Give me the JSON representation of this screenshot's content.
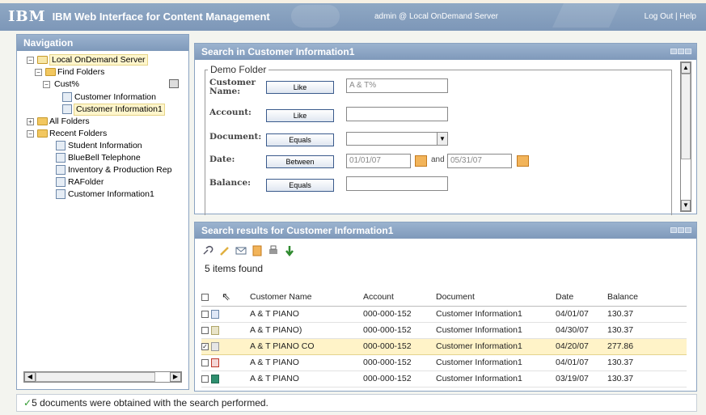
{
  "header": {
    "logo": "IBM",
    "title": "IBM Web Interface for Content Management",
    "user": "admin @ Local OnDemand Server",
    "logout": "Log Out",
    "separator": "|",
    "help": "Help"
  },
  "navigation": {
    "title": "Navigation",
    "tree": {
      "server": "Local OnDemand Server",
      "find_folders": "Find Folders",
      "cust": "Cust%",
      "cust_children": [
        "Customer Information",
        "Customer Information1"
      ],
      "all_folders": "All Folders",
      "recent_folders": "Recent Folders",
      "recent_children": [
        "Student Information",
        "BlueBell Telephone",
        "Inventory & Production Rep",
        "RAFolder",
        "Customer Information1"
      ]
    }
  },
  "search": {
    "title": "Search in Customer Information1",
    "folder": "Demo Folder",
    "fields": [
      {
        "label": "Customer Name:",
        "op": "Like",
        "value": "A & T%"
      },
      {
        "label": "Account:",
        "op": "Like",
        "value": ""
      },
      {
        "label": "Document:",
        "op": "Equals",
        "value": ""
      },
      {
        "label": "Date:",
        "op": "Between",
        "value": "01/01/07",
        "and": "and",
        "value2": "05/31/07"
      },
      {
        "label": "Balance:",
        "op": "Equals",
        "value": ""
      }
    ]
  },
  "results": {
    "title": "Search results for Customer Information1",
    "count_text": "5 items found",
    "columns": [
      "Customer Name",
      "Account",
      "Document",
      "Date",
      "Balance"
    ],
    "rows": [
      {
        "name": "A & T PIANO",
        "account": "000-000-152",
        "document": "Customer Information1",
        "date": "04/01/07",
        "balance": "130.37",
        "checked": false
      },
      {
        "name": "A & T PIANO)",
        "account": "000-000-152",
        "document": "Customer Information1",
        "date": "04/30/07",
        "balance": "130.37",
        "checked": false
      },
      {
        "name": "A & T PIANO CO",
        "account": "000-000-152",
        "document": "Customer Information1",
        "date": "04/20/07",
        "balance": "277.86",
        "checked": true
      },
      {
        "name": "A & T PIANO",
        "account": "000-000-152",
        "document": "Customer Information1",
        "date": "04/01/07",
        "balance": "130.37",
        "checked": false
      },
      {
        "name": "A & T PIANO",
        "account": "000-000-152",
        "document": "Customer Information1",
        "date": "03/19/07",
        "balance": "130.37",
        "checked": false
      }
    ]
  },
  "status": {
    "mark": "✓",
    "text": "5 documents were obtained with the search performed."
  }
}
